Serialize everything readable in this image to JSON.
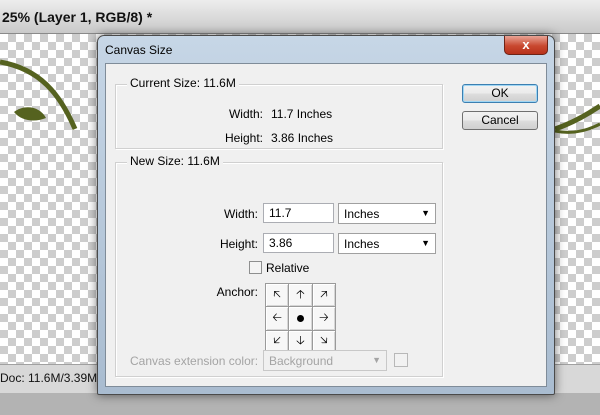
{
  "document": {
    "title": "25% (Layer 1, RGB/8) *",
    "status": "Doc: 11.6M/3.39M"
  },
  "dialog": {
    "title": "Canvas Size",
    "close_label": "x",
    "ok_label": "OK",
    "cancel_label": "Cancel",
    "current_size": {
      "legend": "Current Size: 11.6M",
      "width_label": "Width:",
      "width_value": "11.7 Inches",
      "height_label": "Height:",
      "height_value": "3.86 Inches"
    },
    "new_size": {
      "legend": "New Size: 11.6M",
      "width_label": "Width:",
      "width_value": "11.7",
      "width_unit": "Inches",
      "height_label": "Height:",
      "height_value": "3.86",
      "height_unit": "Inches",
      "relative_label": "Relative",
      "relative_checked": false,
      "anchor_label": "Anchor:",
      "anchor_icons": [
        "arrow-up-left-icon",
        "arrow-up-icon",
        "arrow-up-right-icon",
        "arrow-left-icon",
        "anchor-center-dot-icon",
        "arrow-right-icon",
        "arrow-down-left-icon",
        "arrow-down-icon",
        "arrow-down-right-icon"
      ]
    },
    "extension": {
      "label": "Canvas extension color:",
      "value": "Background"
    }
  },
  "colors": {
    "dialog_frame": "#a9bcd0",
    "close_button": "#c8482f",
    "vine": "#55621f"
  }
}
